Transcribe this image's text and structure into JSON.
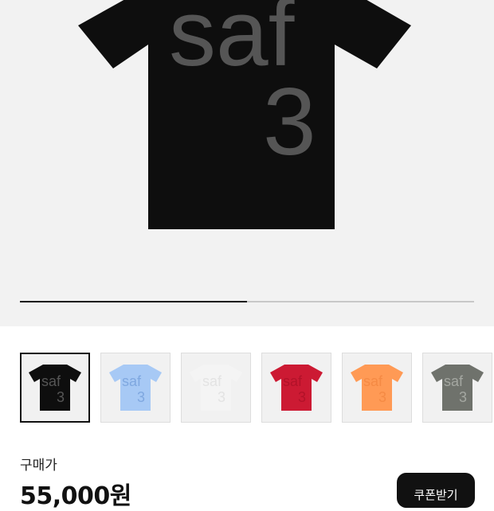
{
  "product": {
    "graphic_text": "saf",
    "graphic_number": "3",
    "price_label": "구매가",
    "price_value": "55,000원",
    "coupon_label": "쿠폰받기"
  },
  "gallery": {
    "progress": 0.5,
    "selected_index": 0
  },
  "colors": [
    {
      "name": "black",
      "shirt": "#0e0e0e",
      "print": "#555555"
    },
    {
      "name": "light-blue",
      "shirt": "#a7c9f5",
      "print": "#7fa8e0"
    },
    {
      "name": "white",
      "shirt": "#f4f4f4",
      "print": "#e3e3e3"
    },
    {
      "name": "red",
      "shirt": "#cc1a33",
      "print": "#b21229"
    },
    {
      "name": "orange",
      "shirt": "#ff9a55",
      "print": "#f58a44"
    },
    {
      "name": "khaki-gray",
      "shirt": "#6f726c",
      "print": "#a4a7a1"
    }
  ]
}
